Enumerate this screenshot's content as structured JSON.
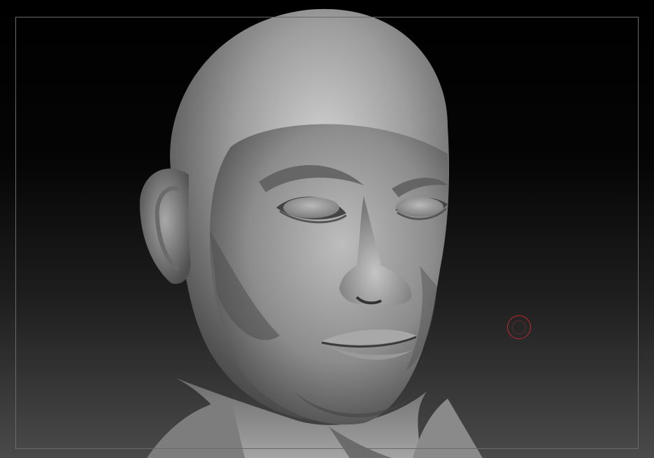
{
  "viewport": {
    "background_top": "#000000",
    "background_bottom": "#4a4a4a",
    "frame_color": "#6a6a6a",
    "model": {
      "icon": "sculpted-head-bust",
      "material_color": "#8f8f8f"
    },
    "brush_cursor": {
      "icon": "brush-circle-icon",
      "color": "#c1272d"
    }
  }
}
